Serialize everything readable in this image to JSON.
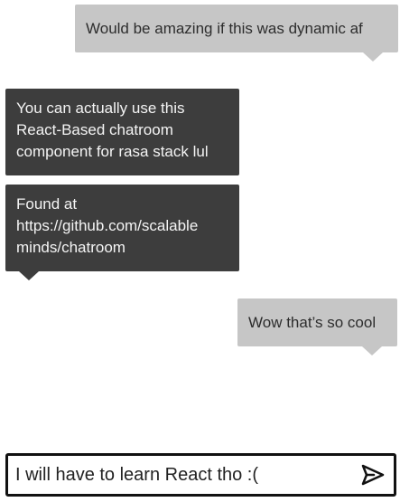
{
  "messages": [
    {
      "sender": "user",
      "text": "Would be amazing if this was dynamic af"
    },
    {
      "sender": "bot",
      "text": "You can actually use this\nReact-Based chatroom\ncomponent for rasa stack lul"
    },
    {
      "sender": "bot",
      "text": "Found at\nhttps://github.com/scalable\nminds/chatroom"
    },
    {
      "sender": "user",
      "text": "Wow that’s so cool"
    }
  ],
  "composer": {
    "value": "I will have to learn React tho :(",
    "send_icon": "send-icon"
  },
  "colors": {
    "user_bubble": "#c6c6c6",
    "bot_bubble": "#3d3d3d",
    "composer_border": "#111111"
  }
}
